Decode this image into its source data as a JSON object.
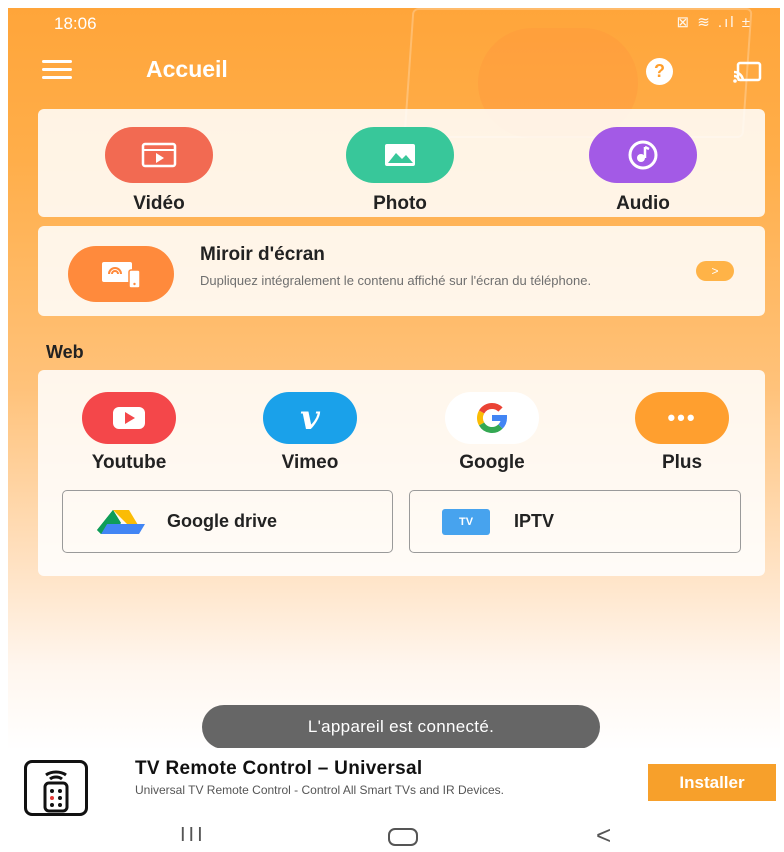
{
  "status_bar": {
    "time": "18:06",
    "icons": "⊠ ≋ .ıl ±"
  },
  "header": {
    "title": "Accueil"
  },
  "media": [
    {
      "label": "Vidéo",
      "color": "#f26a52"
    },
    {
      "label": "Photo",
      "color": "#38c79a"
    },
    {
      "label": "Audio",
      "color": "#a35ae6"
    }
  ],
  "mirror": {
    "title": "Miroir d'écran",
    "description": "Dupliquez intégralement le contenu affiché sur l'écran du téléphone.",
    "arrow": ">"
  },
  "web": {
    "section_title": "Web",
    "items": [
      {
        "label": "Youtube",
        "color": "#f4474a"
      },
      {
        "label": "Vimeo",
        "color": "#1aa1ea"
      },
      {
        "label": "Google",
        "color": "#ffffff"
      },
      {
        "label": "Plus",
        "color": "#ff9f2f"
      }
    ],
    "plus_dots": "•••",
    "buttons": [
      {
        "label": "Google drive"
      },
      {
        "label": "IPTV",
        "icon_text": "TV"
      }
    ]
  },
  "toast": "L'appareil est connecté.",
  "ad": {
    "title": "TV Remote Control – Universal",
    "description": "Universal TV Remote Control - Control All Smart TVs and IR Devices.",
    "install_label": "Installer"
  },
  "navbar": {
    "recent": "III",
    "back": "<"
  }
}
